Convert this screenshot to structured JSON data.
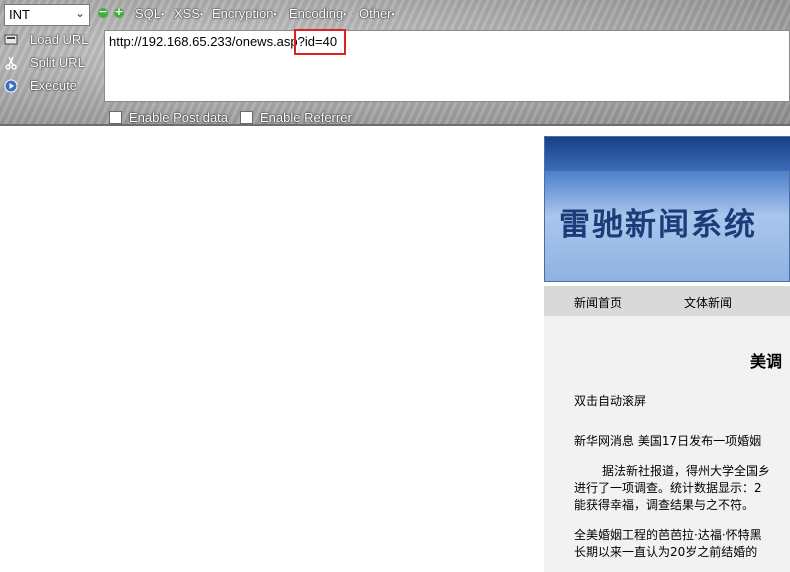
{
  "hackbar": {
    "type_select": {
      "value": "INT"
    },
    "menus": [
      {
        "label": "SQL"
      },
      {
        "label": "XSS"
      },
      {
        "label": "Encryption"
      },
      {
        "label": "Encoding"
      },
      {
        "label": "Other"
      }
    ],
    "buttons": {
      "load_url": "Load URL",
      "split_url": "Split URL",
      "execute": "Execute"
    },
    "url_value": "http://192.168.65.233/onews.asp?id=40",
    "checkboxes": {
      "post_data": "Enable Post data",
      "referrer": "Enable Referrer"
    },
    "colors": {
      "highlight": "#e02020",
      "accent_green": "#3fae3f"
    }
  },
  "site": {
    "banner_title": "雷驰新闻系统",
    "nav": [
      "新闻首页",
      "文体新闻"
    ],
    "article": {
      "title": "美调",
      "auto_scroll": "双击自动滚屏",
      "line1": "新华网消息 美国17日发布一项婚姻",
      "line2": "据法新社报道，得州大学全国乡",
      "line3": "进行了一项调查。统计数据显示：2",
      "line4": "能获得幸福，调查结果与之不符。",
      "line5": "全美婚姻工程的芭芭拉·达福·怀特黑",
      "line6": "长期以来一直认为20岁之前结婚的"
    }
  }
}
